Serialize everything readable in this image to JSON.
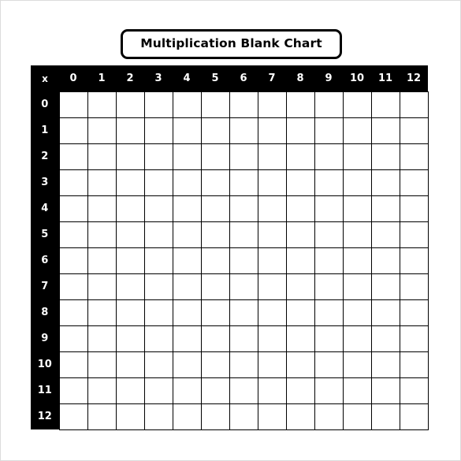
{
  "page": {
    "background_color": "#ffffff",
    "border_color": "#dcdcdc"
  },
  "title": {
    "text": "Multiplication Blank Chart",
    "border_color": "#000000",
    "text_color": "#000000"
  },
  "chart_data": {
    "type": "table",
    "title": "Multiplication Blank Chart",
    "corner_label": "x",
    "header_background": "#000000",
    "header_text_color": "#ffffff",
    "cell_background": "#ffffff",
    "gridline_color": "#000000",
    "columns": [
      "0",
      "1",
      "2",
      "3",
      "4",
      "5",
      "6",
      "7",
      "8",
      "9",
      "10",
      "11",
      "12"
    ],
    "rows": [
      "0",
      "1",
      "2",
      "3",
      "4",
      "5",
      "6",
      "7",
      "8",
      "9",
      "10",
      "11",
      "12"
    ],
    "values": [
      [
        "",
        "",
        "",
        "",
        "",
        "",
        "",
        "",
        "",
        "",
        "",
        "",
        ""
      ],
      [
        "",
        "",
        "",
        "",
        "",
        "",
        "",
        "",
        "",
        "",
        "",
        "",
        ""
      ],
      [
        "",
        "",
        "",
        "",
        "",
        "",
        "",
        "",
        "",
        "",
        "",
        "",
        ""
      ],
      [
        "",
        "",
        "",
        "",
        "",
        "",
        "",
        "",
        "",
        "",
        "",
        "",
        ""
      ],
      [
        "",
        "",
        "",
        "",
        "",
        "",
        "",
        "",
        "",
        "",
        "",
        "",
        ""
      ],
      [
        "",
        "",
        "",
        "",
        "",
        "",
        "",
        "",
        "",
        "",
        "",
        "",
        ""
      ],
      [
        "",
        "",
        "",
        "",
        "",
        "",
        "",
        "",
        "",
        "",
        "",
        "",
        ""
      ],
      [
        "",
        "",
        "",
        "",
        "",
        "",
        "",
        "",
        "",
        "",
        "",
        "",
        ""
      ],
      [
        "",
        "",
        "",
        "",
        "",
        "",
        "",
        "",
        "",
        "",
        "",
        "",
        ""
      ],
      [
        "",
        "",
        "",
        "",
        "",
        "",
        "",
        "",
        "",
        "",
        "",
        "",
        ""
      ],
      [
        "",
        "",
        "",
        "",
        "",
        "",
        "",
        "",
        "",
        "",
        "",
        "",
        ""
      ],
      [
        "",
        "",
        "",
        "",
        "",
        "",
        "",
        "",
        "",
        "",
        "",
        "",
        ""
      ],
      [
        "",
        "",
        "",
        "",
        "",
        "",
        "",
        "",
        "",
        "",
        "",
        "",
        ""
      ]
    ]
  }
}
